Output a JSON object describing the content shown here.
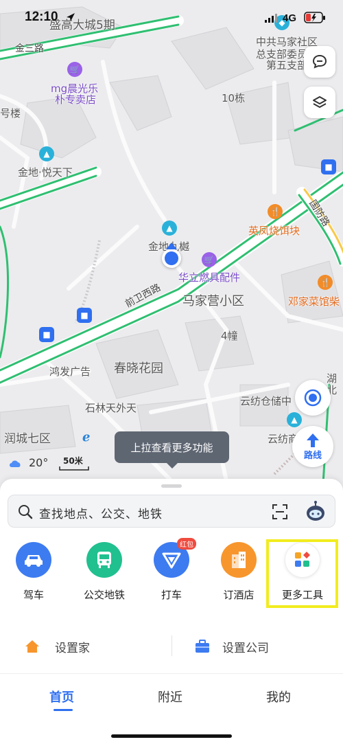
{
  "status_bar": {
    "time": "12:10",
    "network": "4G"
  },
  "map": {
    "labels": {
      "top_city": "盛高大城5期",
      "jinsan_road": "金三路",
      "cpc_line1": "中共马家社区",
      "cpc_line2": "总支部委员",
      "cpc_line3": "第五支部",
      "mg_line1": "mg晨光乐",
      "mg_line2": "朴专卖店",
      "bldg_10": "10栋",
      "left_lou": "号楼",
      "jindi_yuetianxia": "金地·悦天下",
      "jindi_jiuyu": "金地九樾",
      "yingfeng": "英凤烧饵块",
      "qianwei_road": "前卫西路",
      "huali": "华立燃具配件",
      "majiaying": "马家营小区",
      "dengjia": "邓家菜馆柴",
      "bldg_4": "4幢",
      "honfa": "鸿发广告",
      "chunxiao": "春晓花园",
      "shilin": "石林天外天",
      "yunfang_warehouse": "云纺仓储中",
      "yunfang_shang": "云纺商",
      "runcheng": "润城七区",
      "hubei_a": "湖",
      "hubei_b": "北",
      "right_road": "国防路"
    }
  },
  "controls": {
    "route_label": "路线",
    "pull_tip": "上拉查看更多功能",
    "weather_temp": "20°",
    "scale": "50米"
  },
  "search": {
    "placeholder": "查找地点、公交、地铁"
  },
  "shortcuts": [
    {
      "label": "驾车",
      "icon": "car-icon",
      "color": "#3d7bf0"
    },
    {
      "label": "公交地铁",
      "icon": "bus-icon",
      "color": "#21c08f"
    },
    {
      "label": "打车",
      "icon": "taxi-icon",
      "color": "#3d7bf0",
      "badge": "红包"
    },
    {
      "label": "订酒店",
      "icon": "hotel-icon",
      "color": "#f7962d"
    },
    {
      "label": "更多工具",
      "icon": "more-tools-icon",
      "color": "#ffffff"
    }
  ],
  "places": {
    "home": "设置家",
    "company": "设置公司"
  },
  "tabs": {
    "home": "首页",
    "nearby": "附近",
    "mine": "我的"
  },
  "colors": {
    "accent": "#2f6ff0",
    "road_green": "#2fbf71",
    "highlight": "#f2ec1e"
  }
}
